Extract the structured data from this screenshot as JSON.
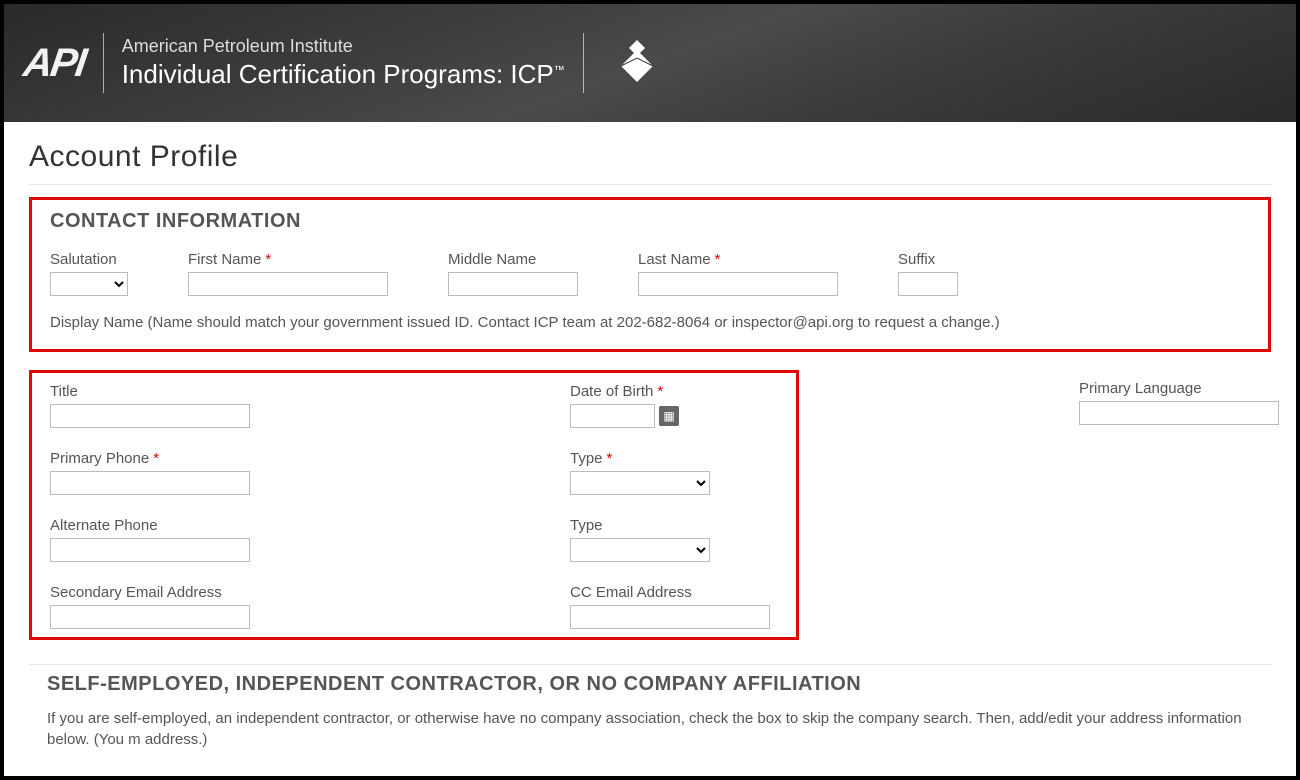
{
  "header": {
    "logo_text": "API",
    "line1": "American Petroleum Institute",
    "line2_a": "Individual Certification Programs: ICP",
    "tm": "™"
  },
  "page_title": "Account Profile",
  "contact": {
    "section_title": "CONTACT INFORMATION",
    "salutation_label": "Salutation",
    "first_name_label": "First Name",
    "middle_name_label": "Middle Name",
    "last_name_label": "Last Name",
    "suffix_label": "Suffix",
    "display_name_help": "Display Name (Name should match your government issued ID. Contact ICP team at 202-682-8064 or inspector@api.org to request a change.)"
  },
  "details": {
    "title_label": "Title",
    "dob_label": "Date of Birth",
    "primary_language_label": "Primary Language",
    "primary_phone_label": "Primary Phone",
    "type1_label": "Type",
    "alternate_phone_label": "Alternate Phone",
    "type2_label": "Type",
    "secondary_email_label": "Secondary Email Address",
    "cc_email_label": "CC Email Address"
  },
  "self_employed": {
    "section_title": "SELF-EMPLOYED, INDEPENDENT CONTRACTOR, OR NO COMPANY AFFILIATION",
    "desc": "If you are self-employed, an independent contractor, or otherwise have no company association, check the box to skip the company search. Then, add/edit your address information below. (You m address.)"
  },
  "required_marker": "*"
}
